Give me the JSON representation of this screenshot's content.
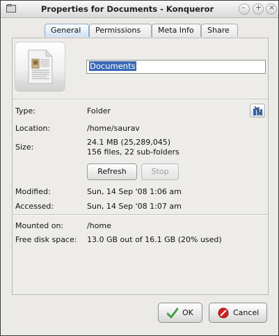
{
  "window": {
    "title": "Properties for Documents - Konqueror"
  },
  "tabs": [
    {
      "label": "General",
      "active": true
    },
    {
      "label": "Permissions",
      "active": false
    },
    {
      "label": "Meta Info",
      "active": false
    },
    {
      "label": "Share",
      "active": false
    }
  ],
  "name_field": {
    "value": "Documents"
  },
  "info": {
    "type_label": "Type:",
    "type_value": "Folder",
    "location_label": "Location:",
    "location_value": "/home/saurav",
    "size_label": "Size:",
    "size_value_1": "24.1 MB (25,289,045)",
    "size_value_2": "156 files, 22 sub-folders",
    "modified_label": "Modified:",
    "modified_value": "Sun, 14 Sep '08 1:06 am",
    "accessed_label": "Accessed:",
    "accessed_value": "Sun, 14 Sep '08 1:07 am",
    "mounted_label": "Mounted on:",
    "mounted_value": "/home",
    "free_label": "Free disk space:",
    "free_value": "13.0 GB out of 16.1 GB (20% used)"
  },
  "buttons": {
    "refresh": "Refresh",
    "stop": "Stop",
    "ok": "OK",
    "cancel": "Cancel"
  },
  "icons": {
    "title": "folder-window-icon",
    "folder": "document-folder-icon",
    "config": "configure-icon",
    "ok": "check-icon",
    "cancel": "cancel-icon"
  },
  "colors": {
    "selection": "#3969b6",
    "ok_icon": "#3ea23a",
    "cancel_icon": "#d62020"
  }
}
